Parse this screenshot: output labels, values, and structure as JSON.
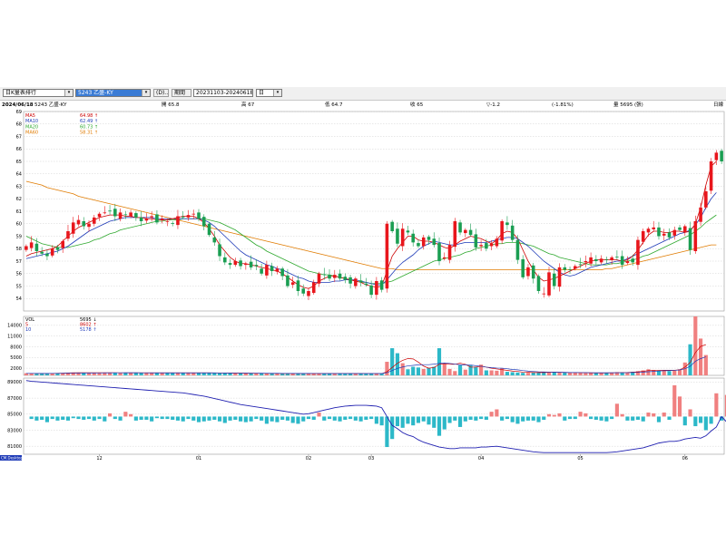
{
  "toolbar": {
    "indicator_select": "日K量表排行",
    "stock_select": "5243 乙盛-KY",
    "period_button": "(D)...",
    "range_label": "期間",
    "range_value": "20231103-20240618",
    "unit_select": "日"
  },
  "info": {
    "date": "2024/06/18",
    "stock": "5243 乙盛-KY",
    "open": "開 65.8",
    "high": "高 67",
    "low": "低 64.7",
    "close": "收 65",
    "change": "▽-1.2",
    "pct": "(-1.81%)",
    "volume": "量 5695 (張)",
    "right": "日線"
  },
  "colors": {
    "up": "#e8161c",
    "down": "#1a9e52",
    "ma5": "#cc0000",
    "ma10": "#1f3bb8",
    "ma20": "#2ea82e",
    "ma60": "#e07b00",
    "vol_up": "#f08080",
    "vol_down": "#2cb8c8",
    "osc": "#1f1fb0"
  },
  "price_legend": [
    {
      "name": "MA5",
      "value": "64.98 ↑"
    },
    {
      "name": "MA10",
      "value": "62.49 ↑"
    },
    {
      "name": "MA20",
      "value": "60.73 ↑"
    },
    {
      "name": "MA60",
      "value": "58.31 ↑"
    }
  ],
  "volume_legend": [
    {
      "name": "VOL",
      "value": "5695 ↓"
    },
    {
      "name": "5",
      "value": "8602 ↑"
    },
    {
      "name": "10",
      "value": "5178 ↑"
    }
  ],
  "bottom_label": "CM.Desktop",
  "chart_data": {
    "type": "candlestick",
    "price_axis": {
      "ticks": [
        "54",
        "55",
        "56",
        "57",
        "58",
        "59",
        "60",
        "61",
        "62",
        "63",
        "64",
        "65",
        "66",
        "67",
        "68",
        "69"
      ],
      "ylim": [
        53,
        69
      ]
    },
    "volume_axis": {
      "ticks": [
        "2000",
        "5000",
        "8000",
        "11000",
        "14000"
      ],
      "ylim": [
        0,
        16500
      ]
    },
    "osc_axis": {
      "ticks": [
        "81000",
        "83000",
        "85000",
        "87000",
        "89000"
      ],
      "ylim": [
        80000,
        89500
      ]
    },
    "x_ticks": [
      {
        "label": "12",
        "index": 14
      },
      {
        "label": "01",
        "index": 33
      },
      {
        "label": "02",
        "index": 54
      },
      {
        "label": "03",
        "index": 66
      },
      {
        "label": "04",
        "index": 87
      },
      {
        "label": "05",
        "index": 106
      },
      {
        "label": "06",
        "index": 126
      }
    ],
    "close": [
      58.2,
      58.5,
      57.8,
      57.6,
      57.4,
      58.0,
      57.9,
      58.6,
      59.4,
      60.1,
      60.3,
      59.8,
      60.0,
      60.5,
      60.8,
      60.9,
      61.0,
      60.6,
      60.9,
      60.7,
      60.9,
      60.5,
      60.2,
      60.4,
      60.6,
      60.1,
      60.4,
      60.2,
      60.0,
      60.6,
      60.5,
      60.7,
      60.8,
      60.4,
      59.8,
      59.1,
      58.5,
      57.4,
      56.9,
      56.7,
      57.0,
      56.6,
      56.8,
      56.5,
      56.6,
      56.0,
      56.7,
      56.2,
      56.4,
      55.8,
      55.0,
      55.3,
      54.6,
      54.4,
      54.6,
      55.3,
      56.0,
      55.9,
      55.6,
      55.9,
      55.6,
      55.5,
      55.2,
      55.6,
      55.3,
      55.1,
      54.3,
      55.4,
      54.7,
      60.0,
      59.4,
      58.4,
      59.6,
      59.3,
      58.5,
      58.2,
      58.9,
      58.7,
      58.3,
      57.0,
      57.3,
      58.3,
      60.2,
      59.3,
      59.5,
      59.1,
      58.1,
      58.3,
      58.0,
      58.4,
      58.8,
      60.2,
      59.9,
      58.7,
      57.1,
      55.7,
      56.5,
      55.6,
      54.6,
      54.4,
      56.1,
      55.0,
      56.5,
      56.3,
      56.3,
      56.6,
      56.7,
      57.0,
      57.3,
      57.0,
      57.2,
      57.1,
      57.3,
      57.3,
      56.7,
      57.0,
      56.9,
      58.7,
      59.4,
      59.6,
      59.7,
      59.0,
      59.2,
      58.9,
      59.5,
      59.5,
      59.8,
      57.9,
      60.2,
      61.3,
      62.6,
      65.0,
      65.7,
      65.0
    ],
    "volume": [
      600,
      550,
      520,
      500,
      480,
      600,
      550,
      620,
      700,
      800,
      750,
      700,
      760,
      720,
      780,
      760,
      700,
      650,
      680,
      700,
      720,
      660,
      680,
      700,
      650,
      700,
      690,
      720,
      730,
      680,
      700,
      720,
      700,
      750,
      650,
      640,
      700,
      600,
      620,
      580,
      560,
      540,
      600,
      560,
      540,
      520,
      560,
      500,
      520,
      500,
      480,
      560,
      520,
      500,
      480,
      500,
      520,
      540,
      500,
      520,
      560,
      500,
      480,
      520,
      460,
      480,
      500,
      520,
      480,
      3800,
      7600,
      6200,
      3400,
      1700,
      2400,
      2200,
      1800,
      2100,
      2400,
      7600,
      3300,
      1800,
      1200,
      2800,
      1600,
      2800,
      2400,
      3000,
      1400,
      1400,
      1300,
      1900,
      1000,
      900,
      800,
      700,
      700,
      900,
      800,
      850,
      900,
      1000,
      800,
      750,
      700,
      700,
      650,
      600,
      650,
      620,
      680,
      700,
      700,
      900,
      800,
      700,
      1000,
      1200,
      1400,
      1700,
      1500,
      1300,
      1300,
      1200,
      1300,
      1700,
      3600,
      8700,
      16500,
      10300,
      5695
    ],
    "ma5": [
      57.4,
      57.6,
      57.7,
      57.8,
      57.9,
      58.0,
      58.2,
      58.6,
      59.0,
      59.4,
      59.7,
      59.9,
      60.1,
      60.3,
      60.5,
      60.6,
      60.7,
      60.7,
      60.7,
      60.6,
      60.6,
      60.5,
      60.5,
      60.4,
      60.4,
      60.3,
      60.3,
      60.3,
      60.4,
      60.5,
      60.6,
      60.6,
      60.6,
      60.4,
      60.1,
      59.6,
      59.0,
      58.3,
      57.8,
      57.3,
      57.0,
      56.8,
      56.8,
      56.7,
      56.6,
      56.5,
      56.4,
      56.3,
      56.2,
      56.0,
      55.7,
      55.4,
      55.1,
      54.9,
      54.8,
      55.0,
      55.4,
      55.6,
      55.8,
      55.8,
      55.7,
      55.6,
      55.5,
      55.4,
      55.3,
      55.1,
      55.0,
      54.9,
      55.0,
      56.2,
      57.4,
      58.0,
      58.5,
      59.0,
      59.0,
      58.7,
      58.6,
      58.6,
      58.5,
      58.3,
      58.1,
      58.0,
      58.3,
      58.6,
      58.8,
      59.0,
      58.9,
      58.8,
      58.6,
      58.4,
      58.7,
      59.2,
      59.4,
      59.3,
      58.8,
      57.9,
      57.0,
      56.3,
      55.7,
      55.4,
      55.5,
      55.6,
      55.8,
      56.0,
      56.2,
      56.4,
      56.6,
      56.8,
      57.0,
      57.1,
      57.1,
      57.1,
      57.1,
      57.1,
      57.0,
      57.1,
      57.4,
      57.9,
      58.5,
      59.1,
      59.4,
      59.4,
      59.3,
      59.3,
      59.4,
      59.4,
      59.3,
      59.4,
      60.0,
      61.3,
      63.1,
      64.6,
      65.0
    ],
    "ma10": [
      57.2,
      57.3,
      57.4,
      57.5,
      57.6,
      57.7,
      57.8,
      58.0,
      58.2,
      58.5,
      58.8,
      59.1,
      59.4,
      59.6,
      59.8,
      60.0,
      60.2,
      60.3,
      60.4,
      60.5,
      60.5,
      60.5,
      60.5,
      60.5,
      60.5,
      60.4,
      60.4,
      60.4,
      60.4,
      60.4,
      60.4,
      60.4,
      60.4,
      60.4,
      60.3,
      60.1,
      59.8,
      59.4,
      59.0,
      58.6,
      58.2,
      57.8,
      57.5,
      57.3,
      57.1,
      56.9,
      56.7,
      56.6,
      56.4,
      56.3,
      56.1,
      55.9,
      55.7,
      55.6,
      55.4,
      55.3,
      55.3,
      55.3,
      55.3,
      55.4,
      55.4,
      55.5,
      55.5,
      55.5,
      55.4,
      55.3,
      55.2,
      55.1,
      55.1,
      55.5,
      56.0,
      56.5,
      56.9,
      57.2,
      57.5,
      57.9,
      58.2,
      58.4,
      58.6,
      58.5,
      58.4,
      58.3,
      58.3,
      58.4,
      58.5,
      58.5,
      58.5,
      58.5,
      58.5,
      58.6,
      58.7,
      58.8,
      58.9,
      58.9,
      58.8,
      58.5,
      58.2,
      57.8,
      57.4,
      57.0,
      56.7,
      56.4,
      56.1,
      55.9,
      55.8,
      55.9,
      56.1,
      56.3,
      56.5,
      56.6,
      56.7,
      56.8,
      56.9,
      57.0,
      57.0,
      57.2,
      57.4,
      57.6,
      57.8,
      58.0,
      58.2,
      58.4,
      58.6,
      58.8,
      59.0,
      59.2,
      59.3,
      59.5,
      59.9,
      60.5,
      61.3,
      62.0,
      62.5
    ],
    "ma20": [
      59.0,
      58.8,
      58.6,
      58.4,
      58.3,
      58.2,
      58.1,
      58.1,
      58.1,
      58.2,
      58.3,
      58.4,
      58.5,
      58.7,
      58.8,
      59.0,
      59.2,
      59.3,
      59.5,
      59.6,
      59.7,
      59.8,
      59.9,
      60.0,
      60.1,
      60.2,
      60.2,
      60.3,
      60.3,
      60.3,
      60.4,
      60.4,
      60.4,
      60.4,
      60.4,
      60.3,
      60.2,
      60.1,
      59.9,
      59.7,
      59.5,
      59.2,
      58.9,
      58.6,
      58.3,
      58.1,
      57.8,
      57.6,
      57.4,
      57.2,
      57.0,
      56.8,
      56.6,
      56.4,
      56.2,
      56.1,
      56.0,
      55.9,
      55.9,
      55.8,
      55.7,
      55.6,
      55.5,
      55.4,
      55.3,
      55.3,
      55.2,
      55.2,
      55.2,
      55.3,
      55.4,
      55.6,
      55.8,
      56.0,
      56.2,
      56.4,
      56.6,
      56.8,
      57.0,
      57.1,
      57.2,
      57.3,
      57.4,
      57.5,
      57.7,
      57.8,
      58.0,
      58.1,
      58.2,
      58.3,
      58.4,
      58.4,
      58.5,
      58.5,
      58.5,
      58.4,
      58.3,
      58.2,
      58.0,
      57.8,
      57.6,
      57.5,
      57.3,
      57.2,
      57.1,
      57.0,
      56.9,
      56.8,
      56.7,
      56.7,
      56.7,
      56.7,
      56.8,
      56.8,
      56.9,
      57.0,
      57.1,
      57.2,
      57.4,
      57.5,
      57.7,
      57.9,
      58.1,
      58.3,
      58.5,
      58.7,
      58.9,
      59.1,
      59.4,
      59.7,
      60.1,
      60.4,
      60.7
    ],
    "ma60": [
      63.4,
      63.3,
      63.2,
      63.1,
      62.9,
      62.8,
      62.7,
      62.6,
      62.5,
      62.4,
      62.2,
      62.1,
      62.0,
      61.9,
      61.8,
      61.7,
      61.6,
      61.5,
      61.4,
      61.3,
      61.2,
      61.1,
      61.0,
      60.9,
      60.8,
      60.7,
      60.6,
      60.5,
      60.4,
      60.3,
      60.2,
      60.1,
      60.0,
      59.9,
      59.8,
      59.7,
      59.6,
      59.5,
      59.4,
      59.3,
      59.2,
      59.1,
      59.0,
      58.9,
      58.8,
      58.7,
      58.6,
      58.5,
      58.4,
      58.3,
      58.2,
      58.1,
      58.0,
      57.9,
      57.8,
      57.7,
      57.6,
      57.5,
      57.4,
      57.3,
      57.2,
      57.1,
      57.0,
      56.9,
      56.8,
      56.7,
      56.6,
      56.5,
      56.4,
      56.4,
      56.4,
      56.3,
      56.3,
      56.3,
      56.3,
      56.3,
      56.3,
      56.3,
      56.3,
      56.3,
      56.3,
      56.3,
      56.3,
      56.3,
      56.3,
      56.3,
      56.3,
      56.3,
      56.3,
      56.3,
      56.3,
      56.3,
      56.3,
      56.3,
      56.3,
      56.3,
      56.3,
      56.3,
      56.3,
      56.3,
      56.3,
      56.3,
      56.3,
      56.3,
      56.3,
      56.3,
      56.3,
      56.3,
      56.3,
      56.3,
      56.3,
      56.4,
      56.4,
      56.5,
      56.6,
      56.7,
      56.8,
      56.9,
      57.0,
      57.1,
      57.2,
      57.3,
      57.4,
      57.5,
      57.6,
      57.7,
      57.8,
      57.9,
      58.0,
      58.1,
      58.2,
      58.3,
      58.3
    ],
    "vol_ma5": [
      560,
      550,
      540,
      530,
      540,
      560,
      580,
      620,
      660,
      700,
      720,
      730,
      740,
      740,
      745,
      750,
      740,
      720,
      710,
      700,
      700,
      690,
      690,
      690,
      690,
      690,
      690,
      700,
      700,
      700,
      700,
      700,
      700,
      700,
      700,
      690,
      680,
      670,
      650,
      630,
      610,
      590,
      580,
      570,
      560,
      550,
      540,
      530,
      520,
      510,
      505,
      500,
      500,
      500,
      500,
      500,
      505,
      510,
      515,
      520,
      525,
      520,
      515,
      505,
      500,
      495,
      490,
      490,
      490,
      1000,
      2200,
      3400,
      4200,
      4700,
      4600,
      3700,
      2600,
      2000,
      2200,
      3100,
      3300,
      3100,
      3100,
      3400,
      3100,
      2300,
      2300,
      2600,
      2300,
      2000,
      1800,
      1600,
      1400,
      1200,
      1100,
      900,
      850,
      800,
      800,
      800,
      850,
      900,
      850,
      830,
      800,
      780,
      750,
      720,
      690,
      660,
      650,
      660,
      690,
      720,
      760,
      800,
      880,
      970,
      1130,
      1350,
      1450,
      1450,
      1440,
      1420,
      1420,
      1550,
      2300,
      3600,
      6400,
      8100,
      8600
    ],
    "vol_ma10": [
      560,
      555,
      550,
      545,
      545,
      550,
      560,
      580,
      600,
      620,
      640,
      650,
      660,
      670,
      680,
      690,
      700,
      710,
      715,
      720,
      720,
      720,
      715,
      710,
      705,
      700,
      700,
      700,
      700,
      700,
      700,
      700,
      700,
      700,
      700,
      695,
      690,
      685,
      675,
      665,
      655,
      645,
      635,
      625,
      615,
      600,
      590,
      580,
      570,
      560,
      550,
      545,
      540,
      535,
      530,
      525,
      520,
      515,
      510,
      510,
      510,
      510,
      510,
      510,
      510,
      505,
      500,
      500,
      500,
      750,
      1350,
      1950,
      2350,
      2650,
      2800,
      2950,
      3000,
      3000,
      3150,
      3350,
      3450,
      3350,
      3150,
      2950,
      2950,
      2900,
      2700,
      2550,
      2300,
      2150,
      2050,
      2000,
      1850,
      1650,
      1550,
      1350,
      1200,
      1100,
      1000,
      950,
      900,
      880,
      850,
      820,
      800,
      790,
      780,
      770,
      750,
      730,
      720,
      720,
      720,
      730,
      740,
      750,
      790,
      840,
      930,
      1020,
      1110,
      1220,
      1300,
      1340,
      1410,
      1520,
      1860,
      2550,
      3950,
      4700,
      5178
    ],
    "osc_line": [
      89200,
      89100,
      89050,
      89000,
      88950,
      88900,
      88850,
      88800,
      88750,
      88700,
      88650,
      88600,
      88550,
      88500,
      88450,
      88400,
      88350,
      88300,
      88250,
      88200,
      88150,
      88100,
      88050,
      88000,
      87950,
      87900,
      87850,
      87800,
      87750,
      87700,
      87650,
      87550,
      87450,
      87350,
      87250,
      87100,
      86950,
      86800,
      86650,
      86500,
      86350,
      86200,
      86100,
      86000,
      85900,
      85800,
      85700,
      85600,
      85500,
      85400,
      85300,
      85200,
      85100,
      85000,
      85050,
      85200,
      85350,
      85500,
      85650,
      85800,
      85900,
      86000,
      86050,
      86100,
      86100,
      86100,
      86050,
      86000,
      85800,
      84700,
      83600,
      83200,
      82700,
      82400,
      82200,
      81800,
      81500,
      81300,
      81100,
      80900,
      80800,
      80700,
      80700,
      80800,
      80800,
      80800,
      80800,
      80900,
      80900,
      80950,
      81000,
      80900,
      80800,
      80700,
      80600,
      80500,
      80400,
      80300,
      80250,
      80200,
      80200,
      80200,
      80200,
      80200,
      80200,
      80200,
      80200,
      80200,
      80200,
      80200,
      80200,
      80200,
      80250,
      80300,
      80400,
      80500,
      80600,
      80700,
      80800,
      81000,
      81200,
      81400,
      81500,
      81600,
      81600,
      81700,
      81900,
      82000,
      82100,
      82000,
      82300,
      82900,
      83400,
      84700,
      84000
    ],
    "osc_bar": [
      0,
      -300,
      -500,
      -400,
      -700,
      -300,
      -500,
      -400,
      -500,
      -200,
      -300,
      -400,
      -300,
      -500,
      -300,
      -600,
      400,
      -300,
      -500,
      600,
      300,
      -500,
      -400,
      -400,
      -600,
      -200,
      -300,
      -300,
      -400,
      -500,
      -600,
      -300,
      -500,
      -700,
      -600,
      -500,
      -400,
      -600,
      -800,
      -500,
      -400,
      -600,
      -700,
      -600,
      -300,
      -500,
      -900,
      -600,
      -700,
      -400,
      -500,
      -800,
      -900,
      -600,
      -300,
      -400,
      500,
      -500,
      -300,
      -500,
      -600,
      -400,
      -300,
      -500,
      -600,
      -400,
      -300,
      -900,
      -1100,
      -3800,
      -2800,
      -1200,
      -1400,
      -900,
      -1100,
      -800,
      -600,
      -1000,
      -1400,
      -2400,
      -1600,
      -800,
      -500,
      -1300,
      -600,
      -400,
      -500,
      -300,
      -400,
      600,
      900,
      -500,
      -300,
      -700,
      -900,
      -600,
      -500,
      -500,
      -700,
      -400,
      300,
      200,
      400,
      -500,
      -300,
      -300,
      600,
      400,
      -300,
      -400,
      -500,
      -600,
      -300,
      1600,
      300,
      -500,
      -500,
      -400,
      -600,
      500,
      400,
      -700,
      500,
      -400,
      3900,
      2500,
      -1100,
      900,
      -1200,
      -800,
      -1700,
      -900,
      2900,
      -500,
      2700,
      3100,
      -1100,
      -3200
    ]
  }
}
